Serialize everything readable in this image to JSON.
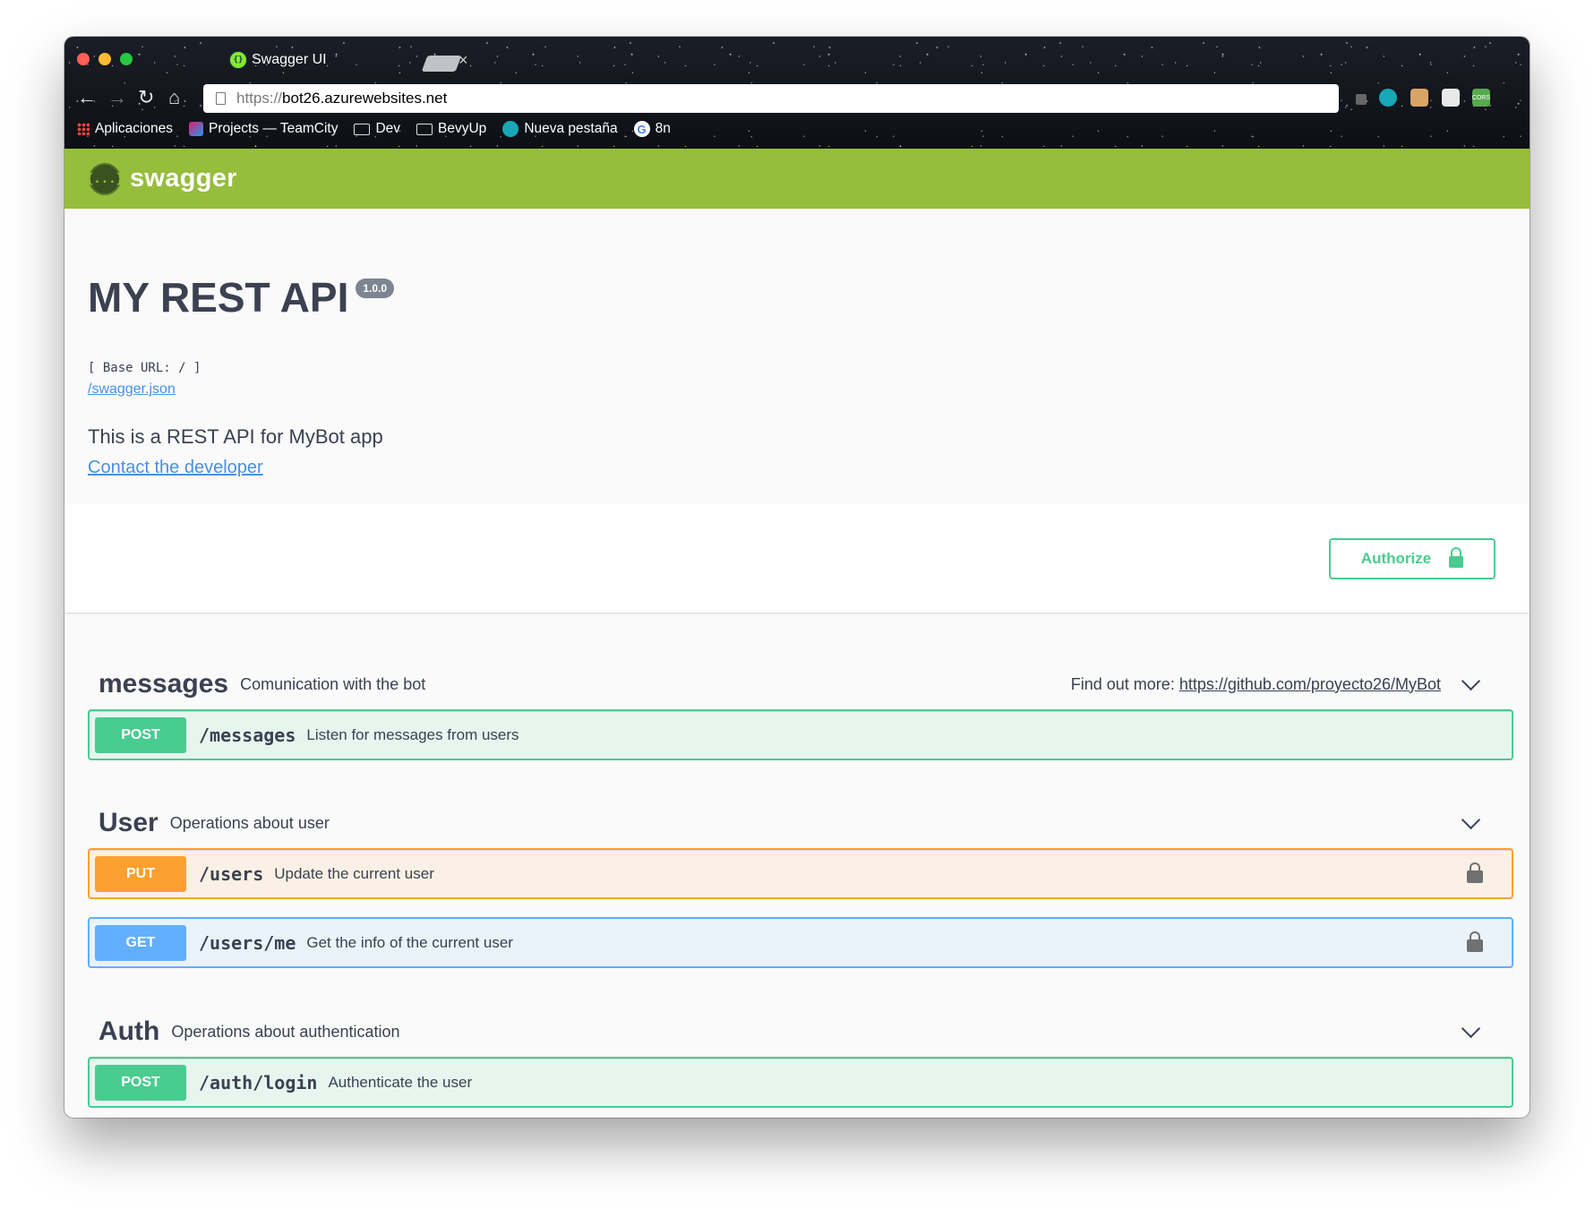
{
  "browser": {
    "tab_title": "Swagger UI",
    "tab_close": "×",
    "url_scheme": "https://",
    "url_host": "bot26.azurewebsites.net",
    "nav_icons": [
      "back-arrow-icon",
      "forward-arrow-icon",
      "reload-icon",
      "home-icon"
    ],
    "extension_labels": {
      "cors": "CORS"
    },
    "bookmarks": [
      {
        "label": "Aplicaciones",
        "icon": "apps-grid-icon"
      },
      {
        "label": "Projects — TeamCity",
        "icon": "teamcity-icon"
      },
      {
        "label": "Dev",
        "icon": "folder-icon"
      },
      {
        "label": "BevyUp",
        "icon": "folder-icon"
      },
      {
        "label": "Nueva pestaña",
        "icon": "circle-icon"
      },
      {
        "label": "8n",
        "icon": "google-icon"
      }
    ]
  },
  "topbar": {
    "logo_text": "swagger",
    "logo_glyph": "{...}"
  },
  "info": {
    "title": "MY REST API",
    "version": "1.0.0",
    "base_url": "[ Base URL: / ]",
    "spec_link": "/swagger.json",
    "description": "This is a REST API for MyBot app",
    "contact_link": "Contact the developer"
  },
  "auth": {
    "authorize_label": "Authorize"
  },
  "tags": [
    {
      "name": "messages",
      "description": "Comunication with the bot",
      "external_prefix": "Find out more:",
      "external_url": "https://github.com/proyecto26/MyBot",
      "operations": [
        {
          "method": "POST",
          "path": "/messages",
          "summary": "Listen for messages from users",
          "locked": false
        }
      ]
    },
    {
      "name": "User",
      "description": "Operations about user",
      "operations": [
        {
          "method": "PUT",
          "path": "/users",
          "summary": "Update the current user",
          "locked": true
        },
        {
          "method": "GET",
          "path": "/users/me",
          "summary": "Get the info of the current user",
          "locked": true
        }
      ]
    },
    {
      "name": "Auth",
      "description": "Operations about authentication",
      "operations": [
        {
          "method": "POST",
          "path": "/auth/login",
          "summary": "Authenticate the user",
          "locked": false
        }
      ]
    }
  ],
  "colors": {
    "topbar": "#97bd3d",
    "post": "#49cc90",
    "put": "#fca130",
    "get": "#61affe",
    "link": "#4990e2",
    "text": "#3b4151"
  }
}
